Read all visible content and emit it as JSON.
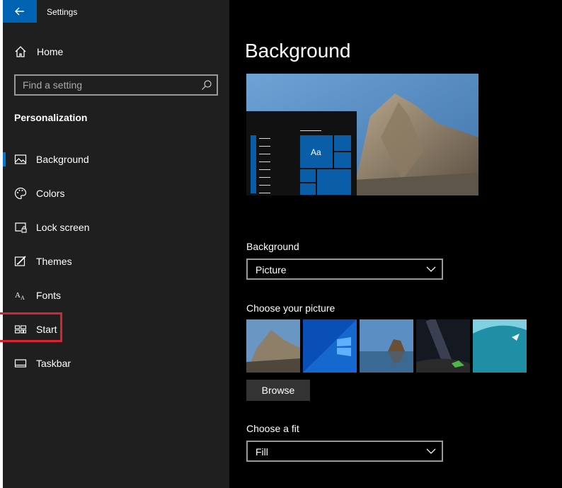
{
  "app": {
    "title": "Settings"
  },
  "sidebar": {
    "home_label": "Home",
    "search_placeholder": "Find a setting",
    "section_title": "Personalization",
    "items": [
      {
        "label": "Background",
        "icon": "picture-icon"
      },
      {
        "label": "Colors",
        "icon": "palette-icon"
      },
      {
        "label": "Lock screen",
        "icon": "lock-screen-icon"
      },
      {
        "label": "Themes",
        "icon": "themes-icon"
      },
      {
        "label": "Fonts",
        "icon": "fonts-icon"
      },
      {
        "label": "Start",
        "icon": "start-icon"
      },
      {
        "label": "Taskbar",
        "icon": "taskbar-icon"
      }
    ]
  },
  "preview": {
    "tile_text": "Aa"
  },
  "main": {
    "title": "Background",
    "background_label": "Background",
    "background_value": "Picture",
    "choose_picture_label": "Choose your picture",
    "browse_label": "Browse",
    "fit_label": "Choose a fit",
    "fit_value": "Fill"
  },
  "colors": {
    "accent": "#0078d7",
    "highlight_box": "#d9232d",
    "sidebar_bg": "#1f1f1f"
  }
}
